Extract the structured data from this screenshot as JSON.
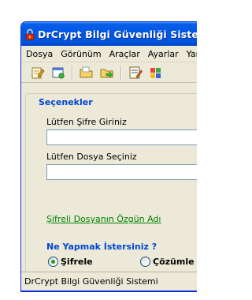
{
  "window": {
    "title": "DrCrypt Bilgi Güvenliği Sistemi"
  },
  "menu": {
    "items": [
      {
        "label": "Dosya"
      },
      {
        "label": "Görünüm"
      },
      {
        "label": "Araçlar"
      },
      {
        "label": "Ayarlar"
      },
      {
        "label": "Yardım"
      }
    ]
  },
  "toolbar": {
    "buttons": [
      {
        "icon": "edit-document-icon"
      },
      {
        "icon": "new-window-icon"
      },
      {
        "icon": "folder-icon"
      },
      {
        "icon": "folder-go-icon"
      },
      {
        "icon": "write-note-icon"
      },
      {
        "icon": "color-grid-icon"
      }
    ]
  },
  "form": {
    "section_title": "Seçenekler",
    "password_label": "Lütfen Şifre Giriniz",
    "password_value": "",
    "file_label": "Lütfen Dosya Seçiniz",
    "file_value": "",
    "original_name_link": "Şifreli Dosyanın Özgün Adı",
    "question": "Ne Yapmak İstersiniz ?",
    "options": [
      {
        "label": "Şifrele",
        "selected": true
      },
      {
        "label": "Çözümle",
        "selected": false
      }
    ]
  },
  "statusbar": {
    "text": "DrCrypt Bilgi Güvenliği Sistemi"
  },
  "colors": {
    "title_bar": "#0058e6",
    "section_title": "#0046d5",
    "link": "#008000",
    "radio_dot": "#21a121"
  }
}
